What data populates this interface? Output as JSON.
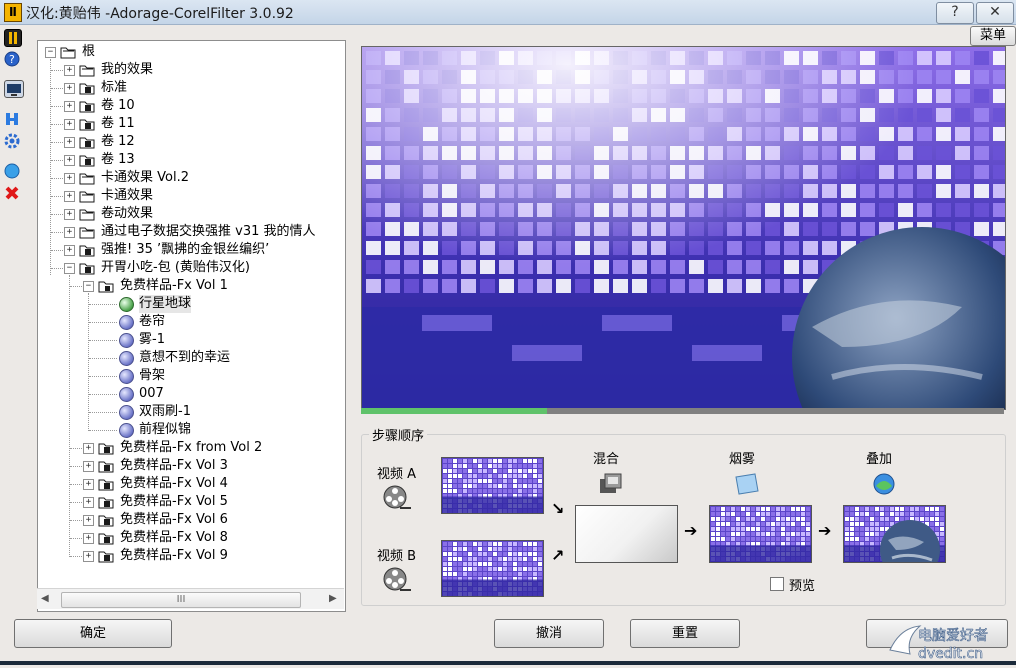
{
  "window": {
    "title": "汉化:黄贻伟 -Adorage-CorelFilter 3.0.92",
    "help_label": "?",
    "close_label": "✕"
  },
  "menu_button": "菜单",
  "tree": {
    "root": "根",
    "items": [
      "我的效果",
      "标准",
      "卷 10",
      "卷 11",
      "卷 12",
      "卷 13",
      "卡通效果 Vol.2",
      "卡通效果",
      "卷动效果",
      "通过电子数据交换强推 v31 我的情人",
      "强推! 35 ’飘拂的金银丝编织’",
      "开胃小吃-包 (黄贻伟汉化)"
    ],
    "sub_group": "免费样品-Fx Vol 1",
    "leaves": [
      "行星地球",
      "卷帘",
      "雾-1",
      "意想不到的幸运",
      "骨架",
      "007",
      "双雨刷-1",
      "前程似锦"
    ],
    "more_groups": [
      "免费样品-Fx from Vol 2",
      "免费样品-Fx Vol 3",
      "免费样品-Fx Vol 4",
      "免费样品-Fx Vol 5",
      "免费样品-Fx Vol 6",
      "免费样品-Fx Vol 8",
      "免费样品-Fx Vol 9"
    ],
    "selected": "行星地球",
    "scroll_grip": "III"
  },
  "preview": {
    "progress": 0.29
  },
  "steps": {
    "title": "步骤顺序",
    "video_a": "视频 A",
    "video_b": "视频 B",
    "mix": "混合",
    "fog": "烟雾",
    "overlay": "叠加",
    "preview_label": "预览",
    "preview_checked": false
  },
  "buttons": {
    "ok": "确定",
    "cancel": "撤消",
    "reset": "重置",
    "last": ""
  },
  "watermark": {
    "text1": "电脑爱好者",
    "text2": "dvedit.cn"
  },
  "colors": {
    "accent": "#6a5ad8",
    "progress": "#5fc26a",
    "selection": "#e6e6e6"
  }
}
